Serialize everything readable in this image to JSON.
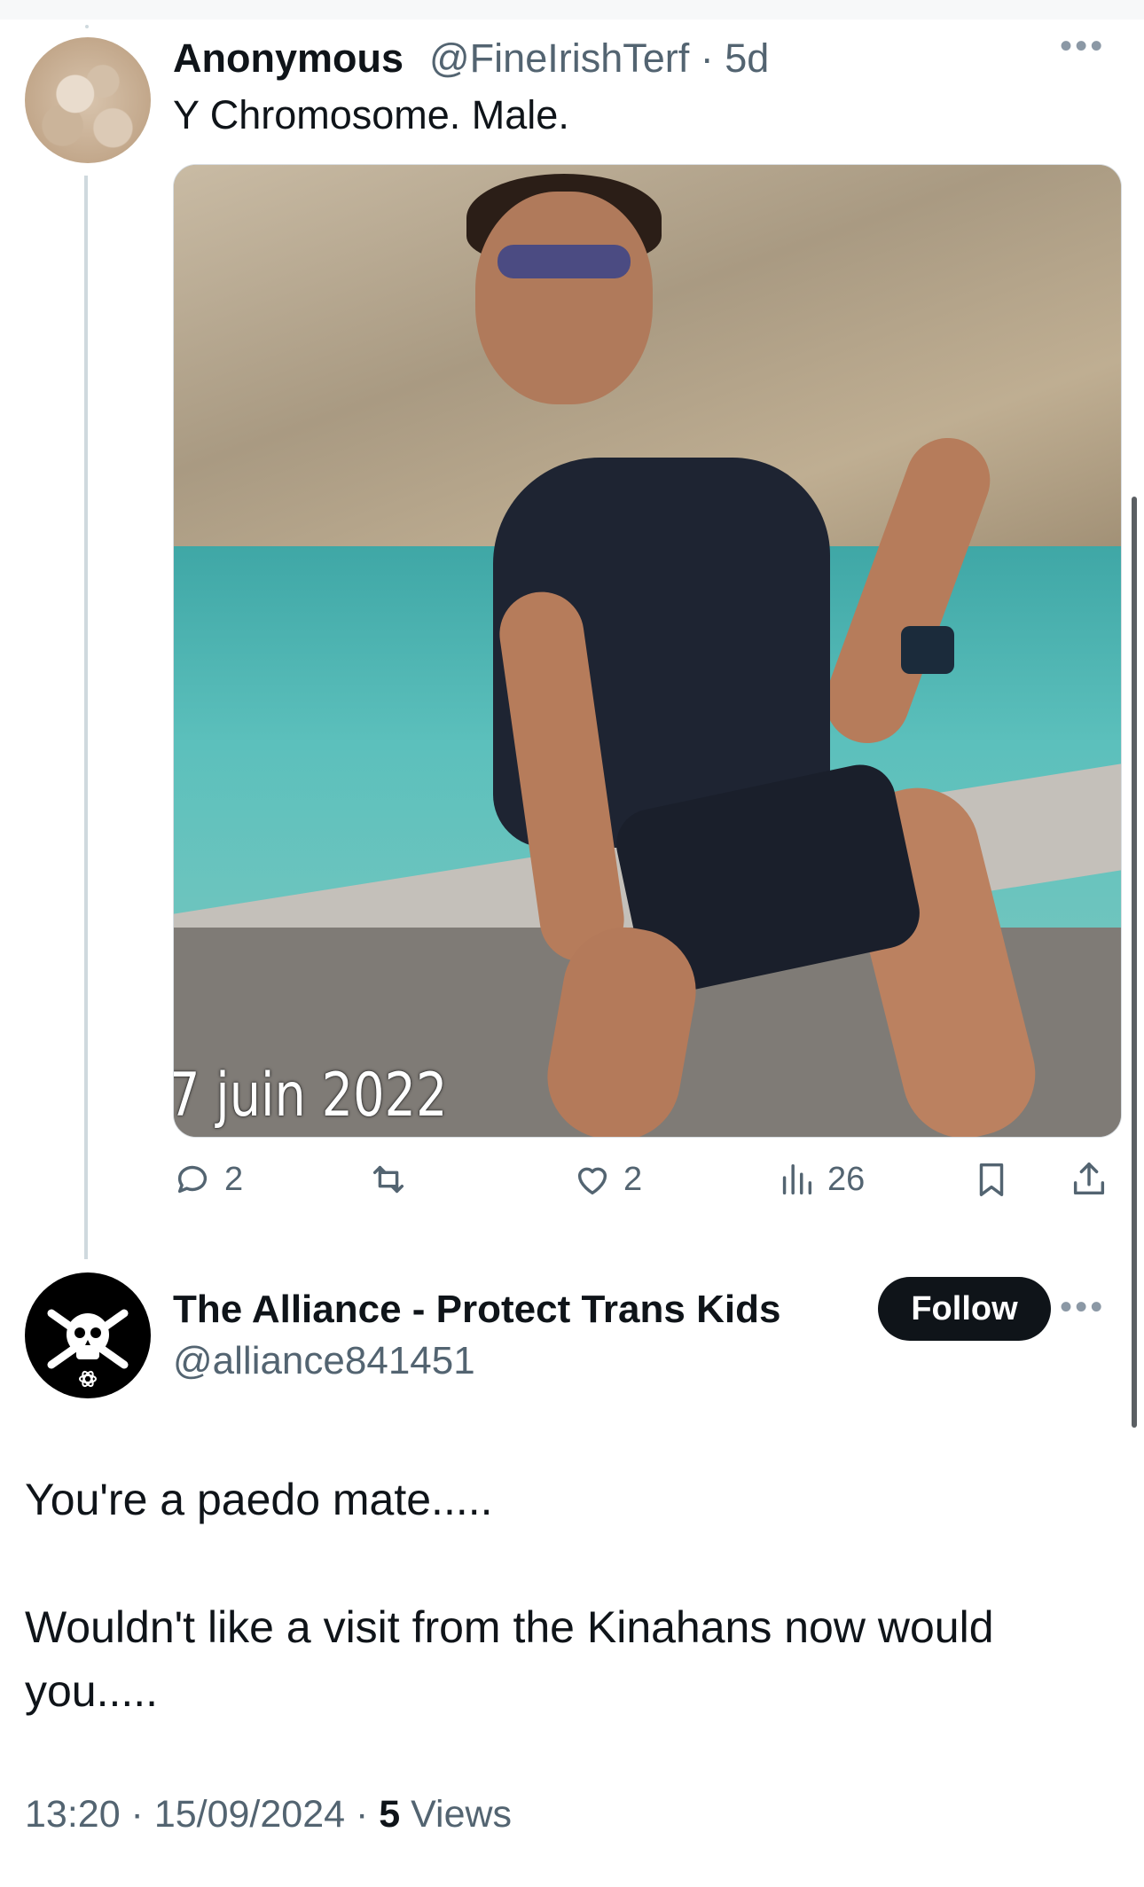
{
  "tweet1": {
    "name": "Anonymous",
    "handle_time": "@FineIrishTerf · 5d",
    "text": "Y Chromosome. Male.",
    "photo_caption": "7 juin 2022",
    "actions": {
      "reply_count": "2",
      "repost_count": "",
      "like_count": "2",
      "views_count": "26"
    }
  },
  "tweet2": {
    "name": "The Alliance - Protect Trans Kids",
    "handle": "@alliance841451",
    "follow_label": "Follow",
    "text_line1": "You're a paedo mate.....",
    "text_line2": "Wouldn't like a visit from the Kinahans now would you.....",
    "meta_time_date": "13:20 · 15/09/2024 · ",
    "meta_views_count": "5",
    "meta_views_label": " Views"
  },
  "icons": {
    "more": "more-icon",
    "reply": "reply-icon",
    "repost": "repost-icon",
    "like": "heart-icon",
    "views": "views-icon",
    "bookmark": "bookmark-icon",
    "share": "share-icon"
  },
  "colors": {
    "text": "#0f1419",
    "secondary": "#536471",
    "thread_line": "#cfd9de",
    "follow_button": "#0f1419"
  }
}
